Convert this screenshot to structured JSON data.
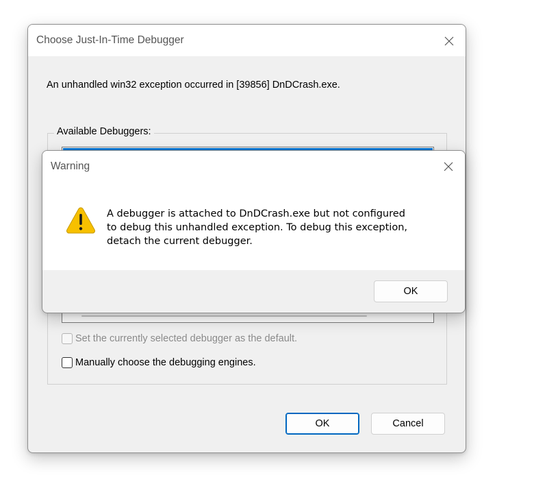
{
  "jit_dialog": {
    "title": "Choose Just-In-Time Debugger",
    "message": "An unhandled win32 exception occurred in [39856] DnDCrash.exe.",
    "available_label": "Available Debuggers:",
    "set_default_label": "Set the currently selected debugger as the default.",
    "set_default_checked": false,
    "set_default_enabled": false,
    "manual_label": "Manually choose the debugging engines.",
    "manual_checked": false,
    "ok_label": "OK",
    "cancel_label": "Cancel",
    "close_icon": "close-icon"
  },
  "warning_dialog": {
    "title": "Warning",
    "message": "A debugger is attached to DnDCrash.exe but not configured\nto debug this unhandled exception. To debug this exception,\ndetach the current debugger.",
    "icon": "warning-icon",
    "ok_label": "OK",
    "close_icon": "close-icon"
  },
  "colors": {
    "accent": "#0078d7",
    "warning_yellow": "#f7c000",
    "dialog_bg": "#f0f0f0"
  }
}
